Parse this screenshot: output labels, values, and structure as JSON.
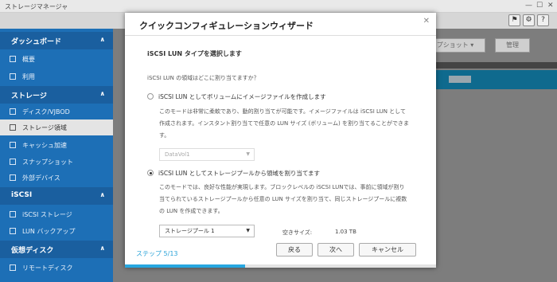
{
  "window": {
    "title": "ストレージマネージャ"
  },
  "sidebar": {
    "sections": [
      {
        "label": "ダッシュボード",
        "items": [
          "概要",
          "利用"
        ]
      },
      {
        "label": "ストレージ",
        "items": [
          "ディスク/VJBOD",
          "ストレージ領域",
          "キャッシュ加速",
          "スナップショット",
          "外部デバイス"
        ]
      },
      {
        "label": "iSCSI",
        "items": [
          "iSCSI ストレージ",
          "LUN バックアップ"
        ]
      },
      {
        "label": "仮想ディスク",
        "items": [
          "リモートディスク"
        ]
      }
    ],
    "active_item": "ストレージ領域"
  },
  "background": {
    "snapshot_button": "プショット ▾",
    "manage_button": "管理"
  },
  "dialog": {
    "title": "クイックコンフィギュレーションウィザード",
    "step_title": "iSCSI LUN タイプを選択します",
    "question": "iSCSI LUN の領域はどこに割り当てますか？",
    "option1": {
      "label": "iSCSI LUN としてボリュームにイメージファイルを作成します",
      "desc1": "このモードは非常に柔軟であり、動的割り当てが可能です。イメージファイルは iSCSI LUN として",
      "desc2": "作成されます。インスタント割り当てで任意の LUN サイズ (ボリューム) を割り当てることができま",
      "desc3": "す。",
      "select_value": "DataVol1",
      "selected": false
    },
    "option2": {
      "label": "iSCSI LUN としてストレージプールから領域を割り当てます",
      "desc1": "このモードでは、良好な性能が実現します。ブロックレベルの iSCSI LUNでは、事前に領域が割り",
      "desc2": "当てられているストレージプールから任意の LUN サイズを割り当て、同じストレージプールに複数",
      "desc3": "の LUN を作成できます。",
      "select_value": "ストレージプール 1",
      "selected": true
    },
    "free_size_label": "空きサイズ:",
    "free_size_value": "1.03 TB",
    "step_counter": "ステップ 5/13",
    "progress": 0.385,
    "buttons": {
      "back": "戻る",
      "next": "次へ",
      "cancel": "キャンセル"
    }
  }
}
